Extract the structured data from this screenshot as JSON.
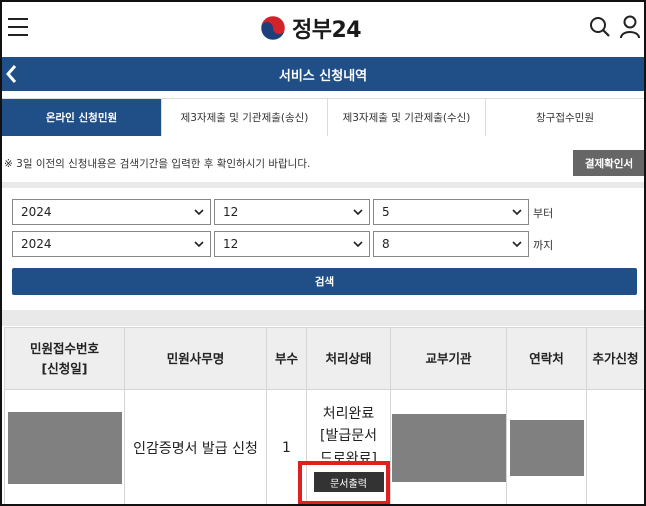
{
  "header": {
    "logo_text": "정부24",
    "icons": [
      "hamburger-menu-icon",
      "government-emblem-icon",
      "search-icon",
      "user-icon"
    ]
  },
  "titlebar": {
    "title": "서비스 신청내역",
    "back_icon": "chevron-left-icon"
  },
  "tabs": [
    {
      "label": "온라인 신청민원",
      "active": true
    },
    {
      "label": "제3자제출 및 기관제출(송신)",
      "active": false
    },
    {
      "label": "제3자제출 및 기관제출(수신)",
      "active": false
    },
    {
      "label": "창구접수민원",
      "active": false
    }
  ],
  "notice": "※ 3일 이전의 신청내용은 검색기간을 입력한 후 확인하시기 바랍니다.",
  "confirm_button": "결제확인서",
  "date_from": {
    "year": "2024",
    "month": "12",
    "day": "5",
    "suffix": "부터"
  },
  "date_to": {
    "year": "2024",
    "month": "12",
    "day": "8",
    "suffix": "까지"
  },
  "search_button": "검색",
  "table": {
    "headers": [
      "민원접수번호\n[신청일]",
      "민원사무명",
      "부수",
      "처리상태",
      "교부기관",
      "연락처",
      "추가신청"
    ],
    "rows": [
      {
        "receipt_no": "",
        "service_name": "인감증명서 발급 신청",
        "copies": "1",
        "status": "처리완료\n[발급문서\n드로완료]",
        "print_button": "문서출력",
        "issuing_agency": "",
        "contact": "",
        "additional": ""
      }
    ]
  },
  "colors": {
    "primary": "#1f4f86",
    "highlight": "#e02020",
    "redaction": "#808080"
  }
}
